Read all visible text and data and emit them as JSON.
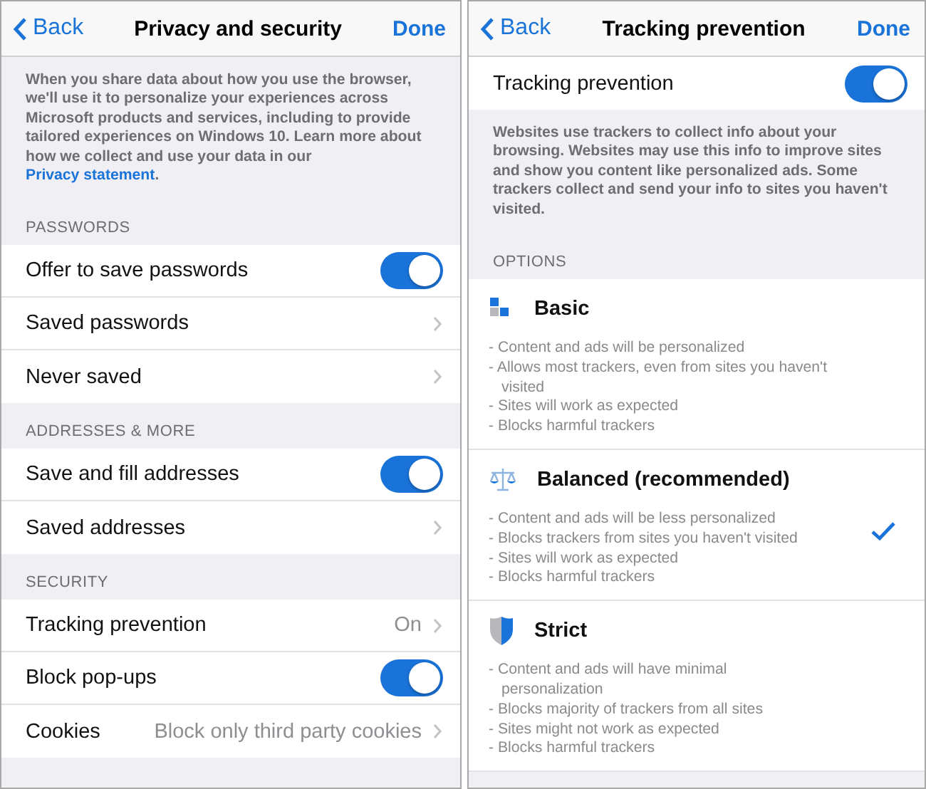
{
  "left": {
    "nav": {
      "back": "Back",
      "title": "Privacy and security",
      "done": "Done"
    },
    "description": {
      "text": "When you share data about how you use the browser, we'll use it to personalize your experiences across Microsoft products and services, including to provide tailored experiences on Windows 10. Learn more about how we collect and use your data in our",
      "link": "Privacy statement",
      "end": "."
    },
    "sections": [
      {
        "header": "PASSWORDS",
        "rows": [
          {
            "kind": "toggle",
            "label": "Offer to save passwords",
            "on": true
          },
          {
            "kind": "link",
            "label": "Saved passwords"
          },
          {
            "kind": "link",
            "label": "Never saved"
          }
        ]
      },
      {
        "header": "ADDRESSES & MORE",
        "rows": [
          {
            "kind": "toggle",
            "label": "Save and fill addresses",
            "on": true
          },
          {
            "kind": "link",
            "label": "Saved addresses"
          }
        ]
      },
      {
        "header": "SECURITY",
        "rows": [
          {
            "kind": "link",
            "label": "Tracking prevention",
            "value": "On"
          },
          {
            "kind": "toggle",
            "label": "Block pop-ups",
            "on": true
          },
          {
            "kind": "link",
            "label": "Cookies",
            "value": "Block only third party cookies"
          }
        ]
      }
    ]
  },
  "right": {
    "nav": {
      "back": "Back",
      "title": "Tracking prevention",
      "done": "Done"
    },
    "toggle": {
      "label": "Tracking prevention",
      "on": true
    },
    "description": "Websites use trackers to collect info about your browsing. Websites may use this info to improve sites and show you content like personalized ads. Some trackers collect and send your info to sites you haven't visited.",
    "options_header": "OPTIONS",
    "options": [
      {
        "kind": "basic",
        "title": "Basic",
        "selected": false,
        "points": [
          "- Content and ads will be personalized",
          "- Allows most trackers, even from sites you haven't visited",
          "- Sites will work as expected",
          "- Blocks harmful trackers"
        ]
      },
      {
        "kind": "balanced",
        "title": "Balanced (recommended)",
        "selected": true,
        "points": [
          "- Content and ads will be less personalized",
          "- Blocks trackers from sites you haven't visited",
          "- Sites will work as expected",
          "- Blocks harmful trackers"
        ]
      },
      {
        "kind": "strict",
        "title": "Strict",
        "selected": false,
        "points": [
          "- Content and ads will have minimal personalization",
          "- Blocks majority of trackers from all sites",
          "- Sites might not work as expected",
          "- Blocks harmful trackers"
        ]
      }
    ]
  }
}
